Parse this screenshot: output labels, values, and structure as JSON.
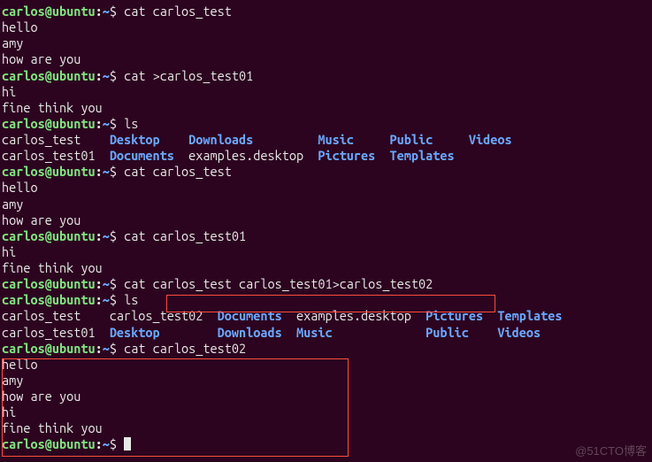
{
  "prompt": {
    "user": "carlos",
    "at": "@",
    "host": "ubuntu",
    "colon": ":",
    "tilde": "~",
    "dollar": "$ "
  },
  "commands": {
    "c1": "cat carlos_test",
    "c2": "cat >carlos_test01",
    "c3": "ls",
    "c4": "cat carlos_test",
    "c5": "cat carlos_test01",
    "c6": "cat carlos_test carlos_test01>carlos_test02",
    "c7": "ls",
    "c8": "cat carlos_test02",
    "c9": ""
  },
  "out": {
    "hello": "hello",
    "amy": "amy",
    "how": "how are you",
    "hi": "hi",
    "fine": "fine think you"
  },
  "ls1": {
    "r1a": "carlos_test    ",
    "r1b": "Desktop",
    "r1b_sp": "    ",
    "r1c": "Downloads",
    "r1c_sp": "         ",
    "r1d": "Music",
    "r1d_sp": "     ",
    "r1e": "Public",
    "r1e_sp": "     ",
    "r1f": "Videos",
    "r2a": "carlos_test01  ",
    "r2b": "Documents",
    "r2b_sp": "  ",
    "r2c": "examples.desktop  ",
    "r2d": "Pictures",
    "r2d_sp": "  ",
    "r2e": "Templates"
  },
  "ls2": {
    "r1a": "carlos_test    ",
    "r1b": "carlos_test02  ",
    "r1c": "Documents",
    "r1c_sp": "  ",
    "r1d": "examples.desktop  ",
    "r1e": "Pictures",
    "r1e_sp": "  ",
    "r1f": "Templates",
    "r2a": "carlos_test01  ",
    "r2b": "Desktop",
    "r2b_sp": "        ",
    "r2c": "Downloads",
    "r2c_sp": "  ",
    "r2d": "Music",
    "r2d_sp": "             ",
    "r2e": "Public",
    "r2e_sp": "    ",
    "r2f": "Videos"
  },
  "watermark": "@51CTO博客"
}
